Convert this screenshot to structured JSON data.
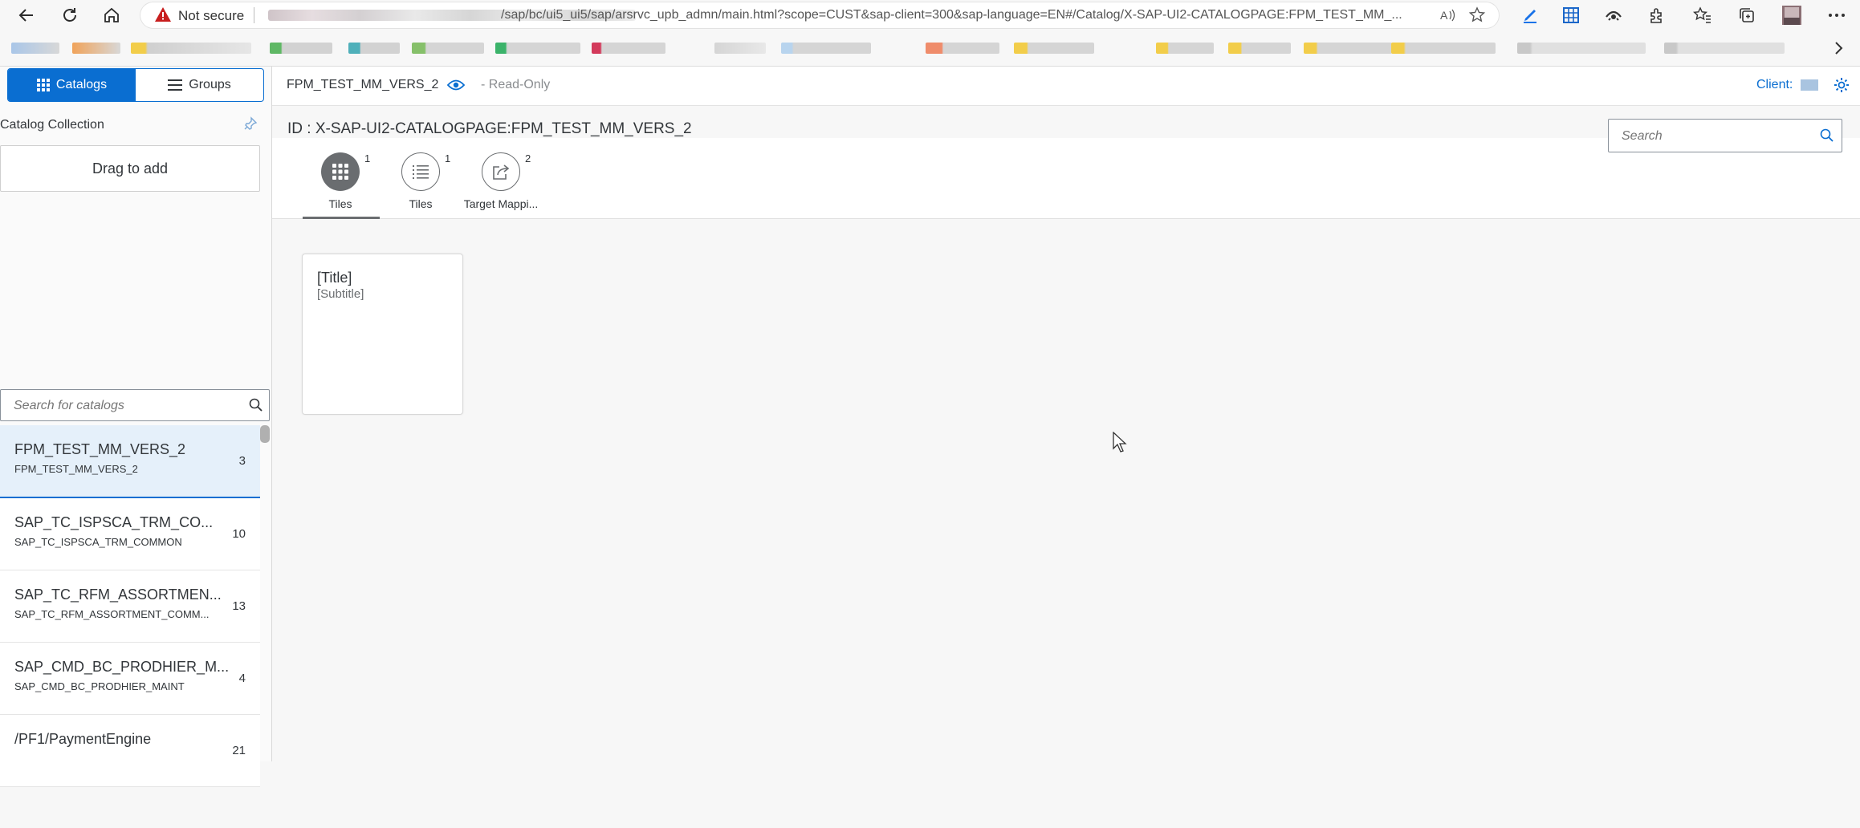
{
  "browser": {
    "security_label": "Not secure",
    "url_visible": "/sap/bc/ui5_ui5/sap/arsrvc_upb_admn/main.html?scope=CUST&sap-client=300&sap-language=EN#/Catalog/X-SAP-UI2-CATALOGPAGE:FPM_TEST_MM_..."
  },
  "left_panel": {
    "catalogs_label": "Catalogs",
    "groups_label": "Groups",
    "collection_title": "Catalog Collection",
    "drag_label": "Drag to add",
    "search_placeholder": "Search for catalogs",
    "catalogs": [
      {
        "title": "FPM_TEST_MM_VERS_2",
        "subtitle": "FPM_TEST_MM_VERS_2",
        "count": "3"
      },
      {
        "title": "SAP_TC_ISPSCA_TRM_CO...",
        "subtitle": "SAP_TC_ISPSCA_TRM_COMMON",
        "count": "10"
      },
      {
        "title": "SAP_TC_RFM_ASSORTMEN...",
        "subtitle": "SAP_TC_RFM_ASSORTMENT_COMM...",
        "count": "13"
      },
      {
        "title": "SAP_CMD_BC_PRODHIER_M...",
        "subtitle": "SAP_CMD_BC_PRODHIER_MAINT",
        "count": "4"
      },
      {
        "title": "/PF1/PaymentEngine",
        "subtitle": "",
        "count": "21"
      }
    ]
  },
  "header": {
    "page_name": "FPM_TEST_MM_VERS_2",
    "mode": "- Read-Only",
    "client_label": "Client:",
    "object_id": "ID : X-SAP-UI2-CATALOGPAGE:FPM_TEST_MM_VERS_2",
    "search_placeholder": "Search"
  },
  "tabs": [
    {
      "label": "Tiles",
      "count": "1",
      "icon": "grid-icon",
      "active": true
    },
    {
      "label": "Tiles",
      "count": "1",
      "icon": "list-icon",
      "active": false
    },
    {
      "label": "Target Mappi...",
      "count": "2",
      "icon": "share-icon",
      "active": false
    }
  ],
  "tile": {
    "title": "[Title]",
    "subtitle": "[Subtitle]"
  },
  "colors": {
    "accent": "#0a6ed1",
    "selected_row": "#e5f0fa",
    "active_tab": "#6a6d70"
  }
}
